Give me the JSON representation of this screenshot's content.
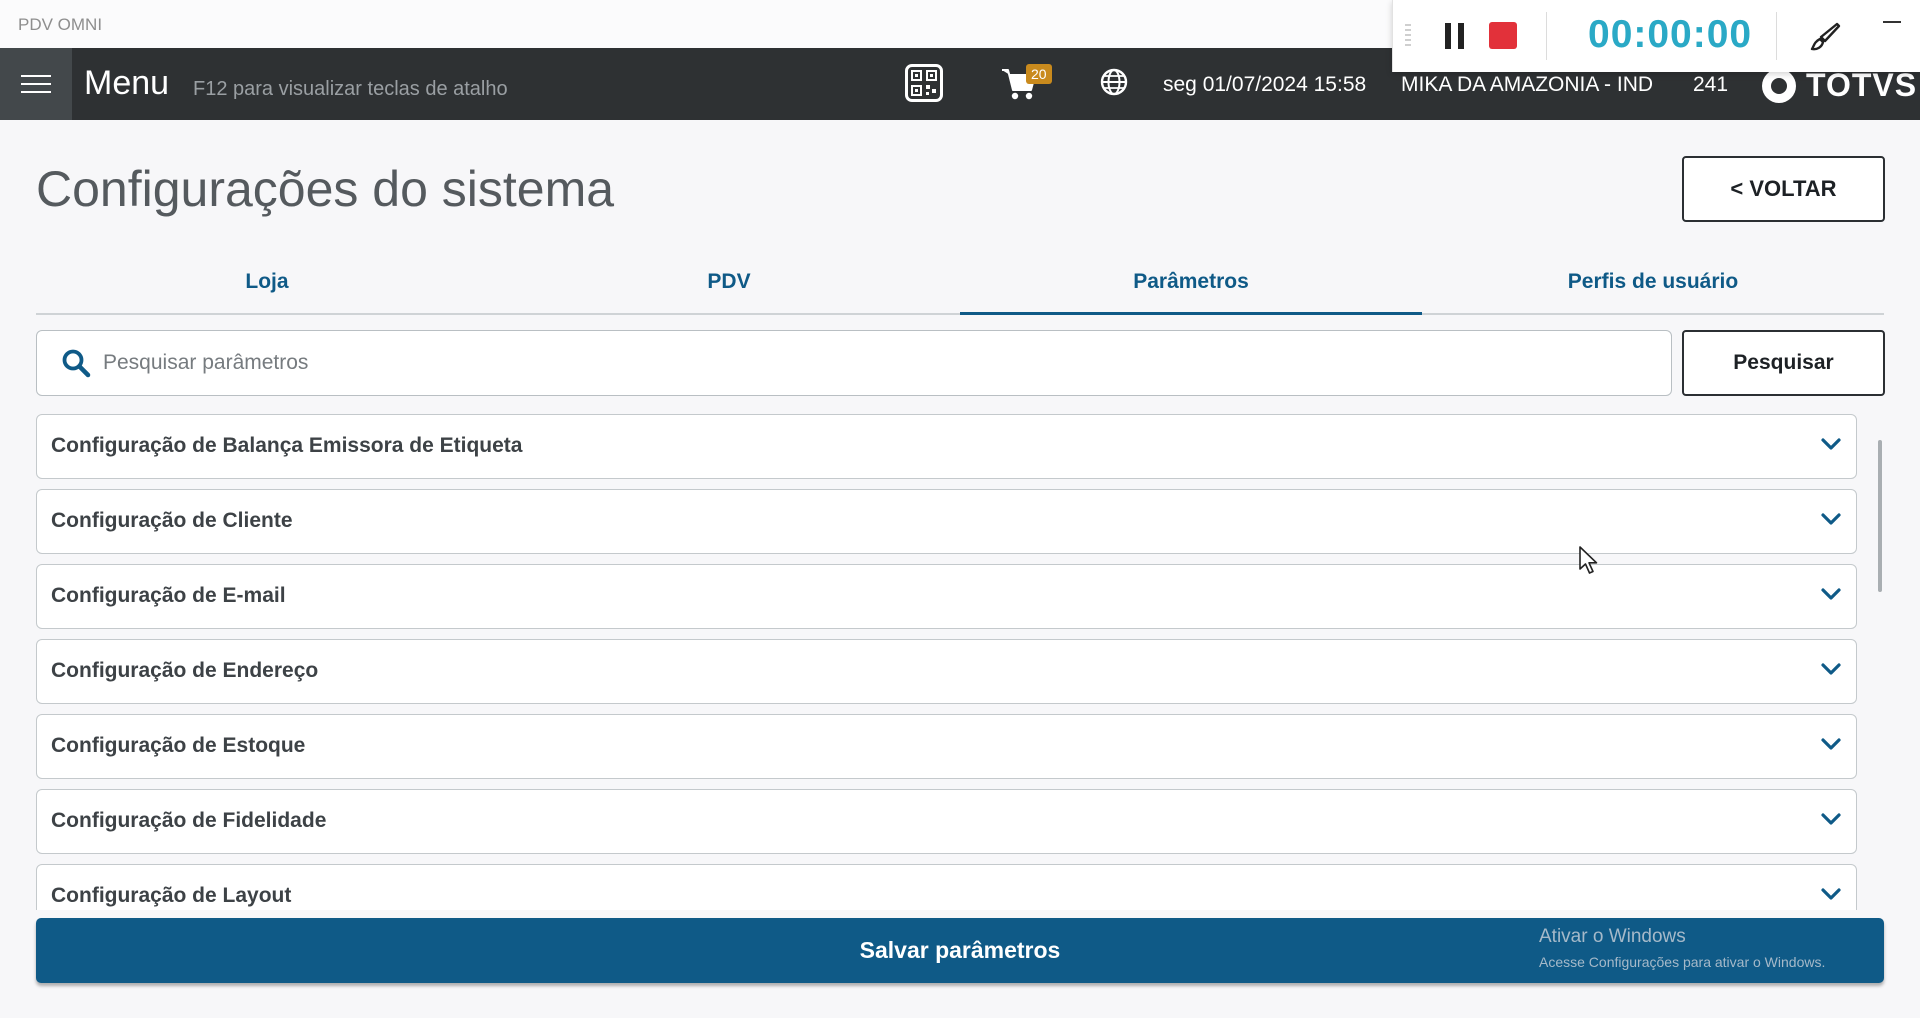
{
  "window": {
    "title": "PDV OMNI"
  },
  "recorder": {
    "timer": "00:00:00"
  },
  "header": {
    "menu_title": "Menu",
    "menu_hint": "F12 para visualizar teclas de atalho",
    "cart_count": "20",
    "datetime": "seg 01/07/2024 15:58",
    "store": "MIKA DA AMAZONIA - IND",
    "pdv_number": "241",
    "logo_text": "TOTVS"
  },
  "page": {
    "title": "Configurações do sistema",
    "back_label": "<  VOLTAR"
  },
  "tabs": [
    {
      "label": "Loja",
      "active": false
    },
    {
      "label": "PDV",
      "active": false
    },
    {
      "label": "Parâmetros",
      "active": true
    },
    {
      "label": "Perfis de usuário",
      "active": false
    }
  ],
  "search": {
    "placeholder": "Pesquisar parâmetros",
    "value": "",
    "button_label": "Pesquisar"
  },
  "sections": [
    "Configuração de Balança Emissora de Etiqueta",
    "Configuração de Cliente",
    "Configuração de E-mail",
    "Configuração de Endereço",
    "Configuração de Estoque",
    "Configuração de Fidelidade",
    "Configuração de Layout"
  ],
  "footer": {
    "save_label": "Salvar parâmetros"
  },
  "watermark": {
    "line1": "Ativar o Windows",
    "line2": "Acesse Configurações para ativar o Windows."
  },
  "colors": {
    "primary": "#0f5a87",
    "header_bg": "#2e3133",
    "timer": "#2aa9c6",
    "stop": "#e2313a",
    "badge": "#c98a1d"
  }
}
